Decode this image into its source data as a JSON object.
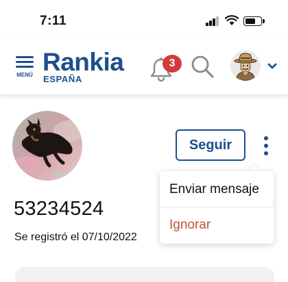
{
  "status_bar": {
    "time": "7:11",
    "icons": [
      "cellular-signal-icon",
      "wifi-icon",
      "battery-icon"
    ]
  },
  "header": {
    "menu_label": "MENÚ",
    "logo": {
      "word": "Rankia",
      "country": "ESPAÑA"
    },
    "notifications_count": "3",
    "brand_color": "#1d4f8c",
    "badge_color": "#d23b3b"
  },
  "profile": {
    "username": "53234524",
    "joined_text": "Se registró el 07/10/2022",
    "follow_label": "Seguir"
  },
  "dropdown_menu": {
    "items": [
      {
        "label": "Enviar mensaje",
        "color": "#111111"
      },
      {
        "label": "Ignorar",
        "color": "#c0533a"
      }
    ]
  }
}
